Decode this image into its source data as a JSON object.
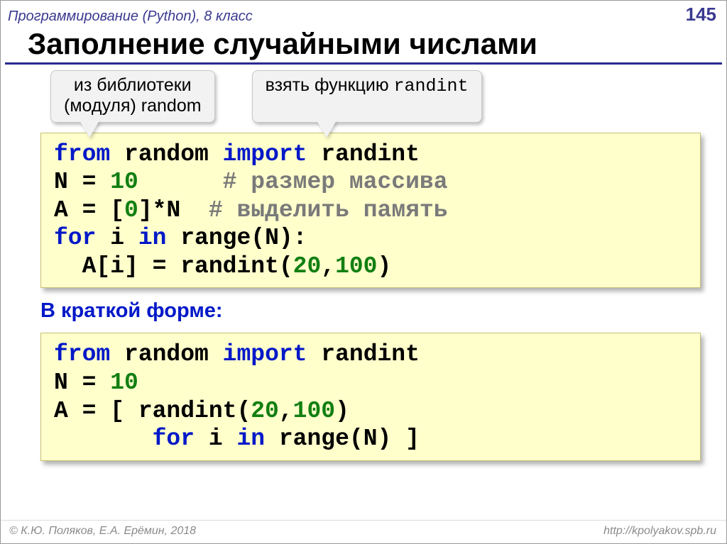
{
  "header": {
    "subject": "Программирование (Python), 8 класс",
    "page": "145"
  },
  "title": "Заполнение случайными числами",
  "callouts": {
    "left_line1": "из библиотеки",
    "left_line2": "(модуля) random",
    "right_pre": "взять функцию ",
    "right_mono": "randint"
  },
  "code1": {
    "l1_kw1": "from",
    "l1_mid": " random ",
    "l1_kw2": "import",
    "l1_end": " randint",
    "l2_pre": "N = ",
    "l2_num": "10",
    "l2_pad": "      ",
    "l2_cmt": "# размер массива",
    "l3_pre": "A = [",
    "l3_num": "0",
    "l3_mid": "]*N  ",
    "l3_cmt": "# выделить память",
    "l4_kw1": "for",
    "l4_a": " i ",
    "l4_kw2": "in",
    "l4_b": " range(N):",
    "l5_pre": "  A[i] = randint(",
    "l5_n1": "20",
    "l5_c": ",",
    "l5_n2": "100",
    "l5_end": ")"
  },
  "subhead": "В краткой форме:",
  "code2": {
    "l1_kw1": "from",
    "l1_mid": " random ",
    "l1_kw2": "import",
    "l1_end": " randint",
    "l2_pre": "N = ",
    "l2_num": "10",
    "l3_pre": "A = [ randint(",
    "l3_n1": "20",
    "l3_c": ",",
    "l3_n2": "100",
    "l3_end": ")",
    "l4_pad": "       ",
    "l4_kw1": "for",
    "l4_a": " i ",
    "l4_kw2": "in",
    "l4_b": " range(N) ]"
  },
  "footer": {
    "left": "© К.Ю. Поляков, Е.А. Ерёмин, 2018",
    "right": "http://kpolyakov.spb.ru"
  }
}
